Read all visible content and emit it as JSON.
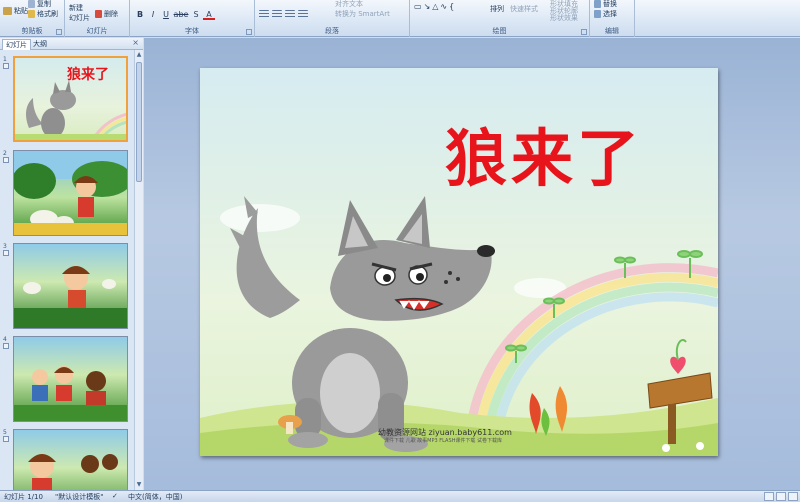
{
  "ribbon": {
    "groups": {
      "clipboard": {
        "label": "剪贴板",
        "paste": "粘贴",
        "copy": "复制",
        "format_painter": "格式刷"
      },
      "slides": {
        "label": "幻灯片",
        "new_slide_line1": "新建",
        "new_slide_line2": "幻灯片",
        "delete": "删除"
      },
      "font": {
        "label": "字体",
        "bold": "B",
        "italic": "I",
        "underline": "U",
        "strike": "abe",
        "shadow": "S",
        "font_color": "A"
      },
      "paragraph": {
        "label": "段落",
        "convert_smartart": "转换为 SmartArt",
        "align_text": "对齐文本"
      },
      "drawing": {
        "label": "绘图",
        "arrange": "排列",
        "quick_styles": "快速样式",
        "shape_fill": "形状填充",
        "shape_outline": "形状轮廓",
        "shape_effects": "形状效果"
      },
      "editing": {
        "label": "编辑",
        "replace": "替换",
        "select": "选择"
      }
    }
  },
  "panel": {
    "tabs": [
      "幻灯片",
      "大纲"
    ],
    "close_glyph": "×",
    "thumbnails": [
      {
        "num": "1",
        "title": "狼来了"
      },
      {
        "num": "2",
        "title": ""
      },
      {
        "num": "3",
        "title": ""
      },
      {
        "num": "4",
        "title": ""
      },
      {
        "num": "5",
        "title": ""
      }
    ]
  },
  "slide": {
    "title": "狼来了",
    "site_text": "幼教资源网站  ziyuan.baby611.com",
    "site_sub": "课件下载   儿歌   故事MP3   FLASH课件下载   试卷下载库"
  },
  "status": {
    "slide_count": "幻灯片 1/10",
    "theme": "\"默认设计模板\"",
    "language": "中文(简体，中国)"
  },
  "colors": {
    "title_red": "#e8141b",
    "selected_thumb_border": "#f0a03c",
    "ribbon_bg": "#dbe7f5",
    "stage_bg": "#a6bcdc"
  }
}
